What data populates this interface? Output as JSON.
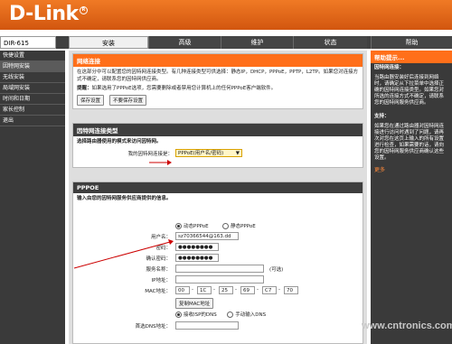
{
  "brand": {
    "logo": "D-Link",
    "reg": "R"
  },
  "model": "DIR-615",
  "tabs": [
    "安装",
    "高级",
    "维护",
    "状态",
    "帮助"
  ],
  "sidebar": [
    "快捷设置",
    "因特网安装",
    "无线安装",
    "局域网安装",
    "时间和日期",
    "家长控制",
    "退出"
  ],
  "sec1": {
    "title": "网络连接",
    "desc": "在这部分中可以配置您的因特网连接类型。有几种连接类型可供选择：静态IP，DHCP，PPPoE，PPTP，L2TP。如果您对连接方式不确定，请联系您的因特网供应商。",
    "note_label": "提醒：",
    "note": "如果选用了PPPoE选项，您需要删除或者禁用您计算机上的任何PPPoE客户端软件。",
    "save": "保存设置",
    "nosave": "不要保存设置"
  },
  "sec2": {
    "title": "因特网连接类型",
    "subtitle": "选择路由器使用的模式来访问因特网。",
    "conn_label": "我的因特网连接是：",
    "conn_value": "PPPoE(用户名/密码)"
  },
  "sec3": {
    "title": "PPPOE",
    "subtitle": "输入由您的因特网服务供应商提供的信息。",
    "mode_dynamic": "动态PPPoE",
    "mode_static": "静态PPPoE",
    "username_label": "用户名：",
    "username": "sz70366544@163.dd",
    "password_label": "密码：",
    "password": "●●●●●●●●",
    "confirm_label": "确认密码：",
    "confirm": "●●●●●●●●",
    "service_label": "服务名称：",
    "optional": "(可选)",
    "ip_label": "IP地址：",
    "mac_label": "MAC地址：",
    "mac": [
      "00",
      "1C",
      "25",
      "69",
      "C7",
      "70"
    ],
    "clone_mac": "复制MAC地址",
    "dns_isp": "接收ISP的DNS",
    "dns_manual": "手动输入DNS",
    "dns_label": "首选DNS地址："
  },
  "help": {
    "title": "帮助提示...",
    "h1": "因特网连接：",
    "p1": "当路由器安装好后连接到网络时，请确定从下拉菜单中选择正确的因特网连接类型。如果您对所选的连接方式不确定，请联系您的因特网服务供应商。",
    "h2": "支持：",
    "p2": "如果您在通过路由器对因特网连接进行访问时遇到了问题，请再次对您在这页上输入的所有设置进行检查，如果需要的话，请向您的因特网服务供应商确认这些设置。",
    "more": "更多"
  },
  "watermark": "www.cntronics.com"
}
